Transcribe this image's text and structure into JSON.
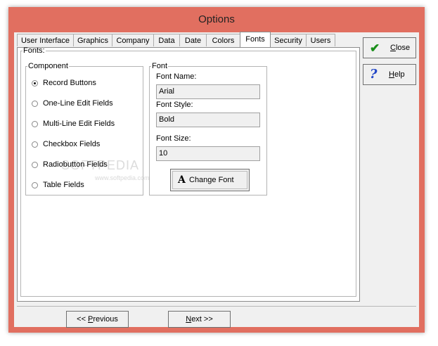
{
  "window": {
    "title": "Options"
  },
  "tabs": [
    {
      "label": "User Interface"
    },
    {
      "label": "Graphics"
    },
    {
      "label": "Company"
    },
    {
      "label": "Data"
    },
    {
      "label": "Date"
    },
    {
      "label": "Colors"
    },
    {
      "label": "Fonts",
      "active": true
    },
    {
      "label": "Security"
    },
    {
      "label": "Users"
    }
  ],
  "fonts_group": {
    "legend": "Fonts:"
  },
  "component": {
    "legend": "Component",
    "options": [
      {
        "label": "Record Buttons",
        "checked": true
      },
      {
        "label": "One-Line Edit Fields",
        "checked": false
      },
      {
        "label": "Multi-Line Edit Fields",
        "checked": false
      },
      {
        "label": "Checkbox Fields",
        "checked": false
      },
      {
        "label": "Radiobutton Fields",
        "checked": false
      },
      {
        "label": "Table Fields",
        "checked": false
      }
    ]
  },
  "font": {
    "legend": "Font",
    "name_label": "Font Name:",
    "name_value": "Arial",
    "style_label": "Font Style:",
    "style_value": "Bold",
    "size_label": "Font Size:",
    "size_value": "10",
    "change_button": {
      "icon_glyph": "A",
      "label": "Change Font"
    }
  },
  "side_buttons": {
    "close": {
      "underline": "C",
      "rest": "lose",
      "icon": "check-icon"
    },
    "help": {
      "underline": "H",
      "rest": "elp",
      "icon": "question-icon"
    }
  },
  "footer": {
    "previous": {
      "prefix": "<< ",
      "underline": "P",
      "rest": "revious"
    },
    "next": {
      "underline": "N",
      "rest": "ext >>"
    }
  },
  "watermark": {
    "main": "SOFTPEDIA",
    "sub": "www.softpedia.com"
  },
  "colors": {
    "titlebar": "#e16f60",
    "accent_check": "#1a8f1a",
    "accent_help": "#2246c7"
  }
}
